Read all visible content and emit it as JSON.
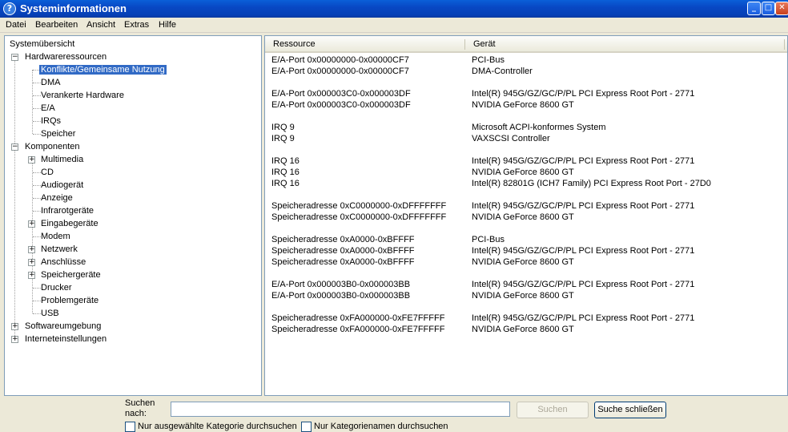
{
  "window": {
    "title": "Systeminformationen",
    "min": "_",
    "max": "□",
    "close": "✕"
  },
  "menu": [
    "Datei",
    "Bearbeiten",
    "Ansicht",
    "Extras",
    "Hilfe"
  ],
  "tree": {
    "root": "Systemübersicht",
    "hardware": {
      "label": "Hardwareressourcen",
      "children": [
        "Konflikte/Gemeinsame Nutzung",
        "DMA",
        "Verankerte Hardware",
        "E/A",
        "IRQs",
        "Speicher"
      ]
    },
    "components": {
      "label": "Komponenten",
      "children": [
        "Multimedia",
        "CD",
        "Audiogerät",
        "Anzeige",
        "Infrarotgeräte",
        "Eingabegeräte",
        "Modem",
        "Netzwerk",
        "Anschlüsse",
        "Speichergeräte",
        "Drucker",
        "Problemgeräte",
        "USB"
      ]
    },
    "software": "Softwareumgebung",
    "internet": "Interneteinstellungen"
  },
  "table": {
    "columns": [
      "Ressource",
      "Gerät"
    ],
    "rows": [
      [
        "E/A-Port 0x00000000-0x00000CF7",
        "PCI-Bus"
      ],
      [
        "E/A-Port 0x00000000-0x00000CF7",
        "DMA-Controller"
      ],
      [
        "",
        ""
      ],
      [
        "E/A-Port 0x000003C0-0x000003DF",
        "Intel(R) 945G/GZ/GC/P/PL PCI Express Root Port - 2771"
      ],
      [
        "E/A-Port 0x000003C0-0x000003DF",
        "NVIDIA GeForce 8600 GT"
      ],
      [
        "",
        ""
      ],
      [
        "IRQ 9",
        "Microsoft ACPI-konformes System"
      ],
      [
        "IRQ 9",
        "VAXSCSI Controller"
      ],
      [
        "",
        ""
      ],
      [
        "IRQ 16",
        "Intel(R) 945G/GZ/GC/P/PL PCI Express Root Port - 2771"
      ],
      [
        "IRQ 16",
        "NVIDIA GeForce 8600 GT"
      ],
      [
        "IRQ 16",
        "Intel(R) 82801G (ICH7 Family) PCI Express Root Port - 27D0"
      ],
      [
        "",
        ""
      ],
      [
        "Speicheradresse 0xC0000000-0xDFFFFFFF",
        "Intel(R) 945G/GZ/GC/P/PL PCI Express Root Port - 2771"
      ],
      [
        "Speicheradresse 0xC0000000-0xDFFFFFFF",
        "NVIDIA GeForce 8600 GT"
      ],
      [
        "",
        ""
      ],
      [
        "Speicheradresse 0xA0000-0xBFFFF",
        "PCI-Bus"
      ],
      [
        "Speicheradresse 0xA0000-0xBFFFF",
        "Intel(R) 945G/GZ/GC/P/PL PCI Express Root Port - 2771"
      ],
      [
        "Speicheradresse 0xA0000-0xBFFFF",
        "NVIDIA GeForce 8600 GT"
      ],
      [
        "",
        ""
      ],
      [
        "E/A-Port 0x000003B0-0x000003BB",
        "Intel(R) 945G/GZ/GC/P/PL PCI Express Root Port - 2771"
      ],
      [
        "E/A-Port 0x000003B0-0x000003BB",
        "NVIDIA GeForce 8600 GT"
      ],
      [
        "",
        ""
      ],
      [
        "Speicheradresse 0xFA000000-0xFE7FFFFF",
        "Intel(R) 945G/GZ/GC/P/PL PCI Express Root Port - 2771"
      ],
      [
        "Speicheradresse 0xFA000000-0xFE7FFFFF",
        "NVIDIA GeForce 8600 GT"
      ]
    ]
  },
  "search": {
    "label": "Suchen nach:",
    "value": "",
    "search_button": "Suchen",
    "close_button": "Suche schließen",
    "option_selected_category": "Nur ausgewählte Kategorie durchsuchen",
    "option_category_names": "Nur Kategorienamen durchsuchen"
  }
}
